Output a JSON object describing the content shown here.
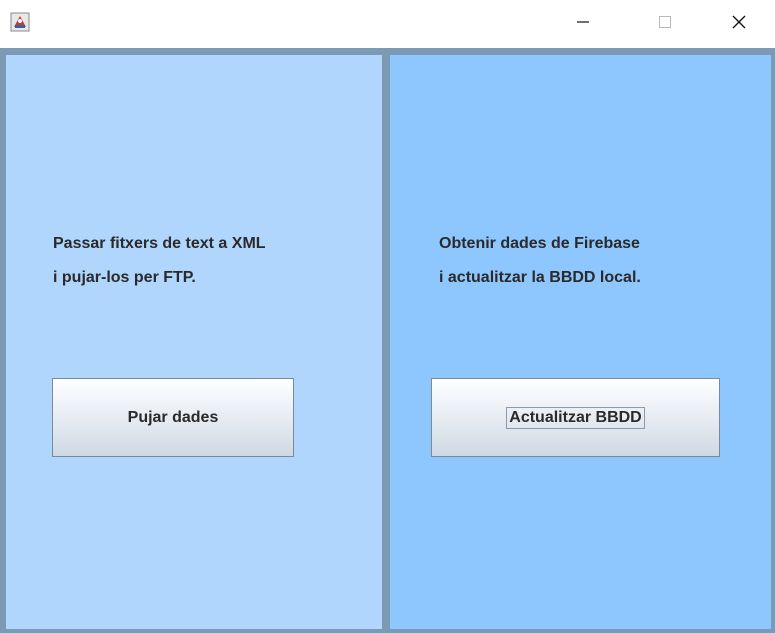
{
  "window": {
    "icon": "java-app-icon",
    "controls": {
      "minimize": "minimize-icon",
      "maximize": "maximize-icon",
      "close": "close-icon"
    }
  },
  "left_panel": {
    "line1": "Passar fitxers de text a XML",
    "line2": "i pujar-los per FTP.",
    "button_label": "Pujar dades"
  },
  "right_panel": {
    "line1": "Obtenir dades de Firebase",
    "line2": "i actualitzar la BBDD local.",
    "button_label": "Actualitzar BBDD"
  },
  "colors": {
    "left_panel_bg": "#b0d6fd",
    "right_panel_bg": "#8ec7fe",
    "frame": "#7d9ab5"
  }
}
